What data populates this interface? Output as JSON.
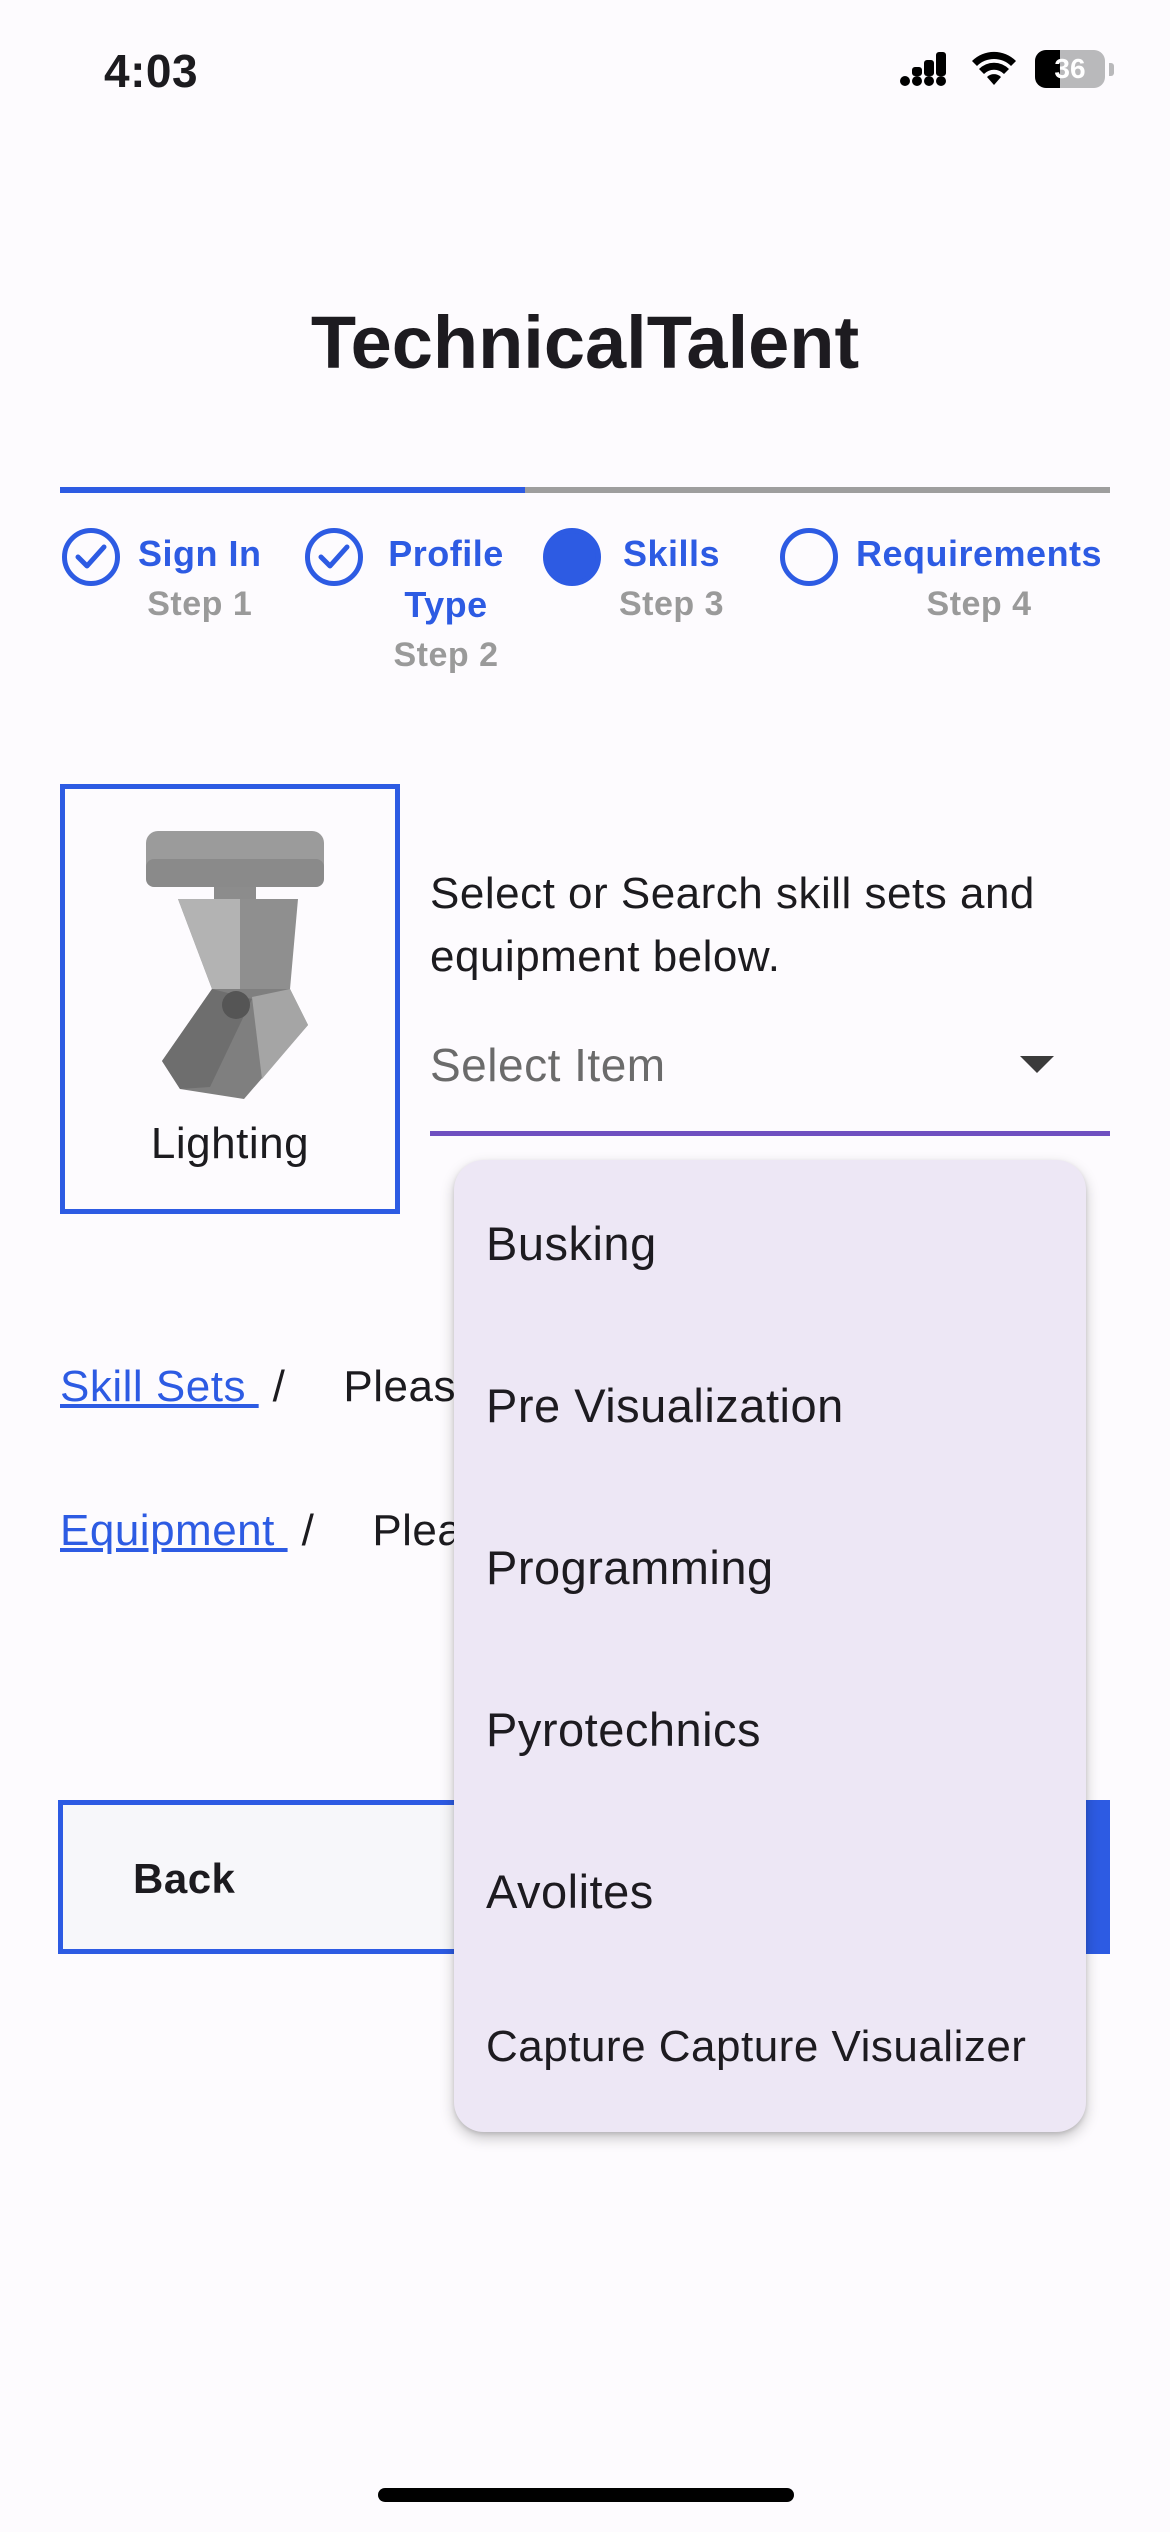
{
  "status_bar": {
    "time": "4:03",
    "battery_level": "36"
  },
  "app_title": "TechnicalTalent",
  "stepper": {
    "progress_fraction": 0.43,
    "steps": [
      {
        "label": "Sign In",
        "step": "Step 1",
        "state": "completed"
      },
      {
        "label": "Profile Type",
        "step": "Step 2",
        "state": "completed"
      },
      {
        "label": "Skills",
        "step": "Step 3",
        "state": "current"
      },
      {
        "label": "Requirements",
        "step": "Step 4",
        "state": "pending"
      }
    ]
  },
  "category": {
    "name": "Lighting",
    "icon": "moving-head-light-icon"
  },
  "instructions": "Select or Search skill sets and equipment below.",
  "select": {
    "placeholder": "Select Item"
  },
  "breadcrumbs": [
    {
      "link": "Skill Sets ",
      "separator": "/",
      "hint": "Pleas"
    },
    {
      "link": "Equipment ",
      "separator": "/",
      "hint": "Plea"
    }
  ],
  "buttons": {
    "back": "Back"
  },
  "menu": {
    "items": [
      "Busking",
      "Pre Visualization",
      "Programming",
      "Pyrotechnics",
      "Avolites",
      "Capture Capture Visualizer"
    ]
  },
  "colors": {
    "accent": "#2d5be3",
    "select_underline": "#6f4fc0",
    "menu_background": "#ede7f5"
  }
}
